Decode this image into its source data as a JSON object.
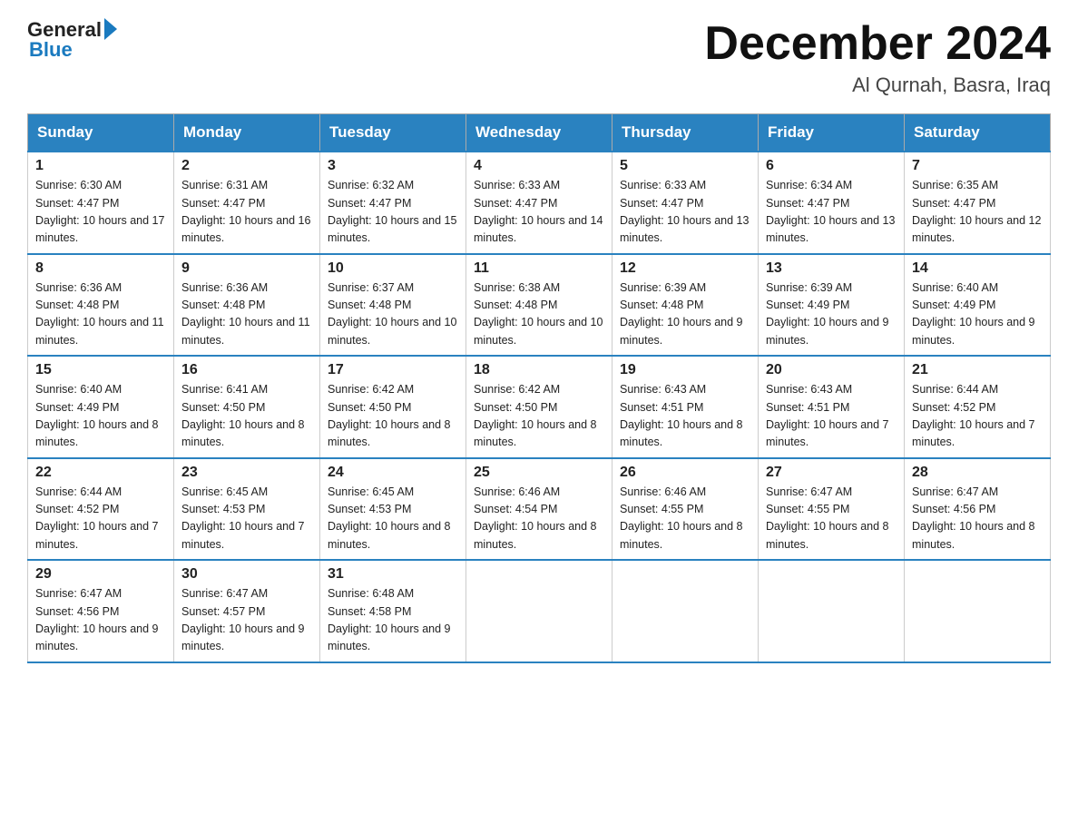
{
  "header": {
    "logo_general": "General",
    "logo_blue": "Blue",
    "month_title": "December 2024",
    "location": "Al Qurnah, Basra, Iraq"
  },
  "days_of_week": [
    "Sunday",
    "Monday",
    "Tuesday",
    "Wednesday",
    "Thursday",
    "Friday",
    "Saturday"
  ],
  "weeks": [
    [
      {
        "day": "1",
        "sunrise": "6:30 AM",
        "sunset": "4:47 PM",
        "daylight": "10 hours and 17 minutes."
      },
      {
        "day": "2",
        "sunrise": "6:31 AM",
        "sunset": "4:47 PM",
        "daylight": "10 hours and 16 minutes."
      },
      {
        "day": "3",
        "sunrise": "6:32 AM",
        "sunset": "4:47 PM",
        "daylight": "10 hours and 15 minutes."
      },
      {
        "day": "4",
        "sunrise": "6:33 AM",
        "sunset": "4:47 PM",
        "daylight": "10 hours and 14 minutes."
      },
      {
        "day": "5",
        "sunrise": "6:33 AM",
        "sunset": "4:47 PM",
        "daylight": "10 hours and 13 minutes."
      },
      {
        "day": "6",
        "sunrise": "6:34 AM",
        "sunset": "4:47 PM",
        "daylight": "10 hours and 13 minutes."
      },
      {
        "day": "7",
        "sunrise": "6:35 AM",
        "sunset": "4:47 PM",
        "daylight": "10 hours and 12 minutes."
      }
    ],
    [
      {
        "day": "8",
        "sunrise": "6:36 AM",
        "sunset": "4:48 PM",
        "daylight": "10 hours and 11 minutes."
      },
      {
        "day": "9",
        "sunrise": "6:36 AM",
        "sunset": "4:48 PM",
        "daylight": "10 hours and 11 minutes."
      },
      {
        "day": "10",
        "sunrise": "6:37 AM",
        "sunset": "4:48 PM",
        "daylight": "10 hours and 10 minutes."
      },
      {
        "day": "11",
        "sunrise": "6:38 AM",
        "sunset": "4:48 PM",
        "daylight": "10 hours and 10 minutes."
      },
      {
        "day": "12",
        "sunrise": "6:39 AM",
        "sunset": "4:48 PM",
        "daylight": "10 hours and 9 minutes."
      },
      {
        "day": "13",
        "sunrise": "6:39 AM",
        "sunset": "4:49 PM",
        "daylight": "10 hours and 9 minutes."
      },
      {
        "day": "14",
        "sunrise": "6:40 AM",
        "sunset": "4:49 PM",
        "daylight": "10 hours and 9 minutes."
      }
    ],
    [
      {
        "day": "15",
        "sunrise": "6:40 AM",
        "sunset": "4:49 PM",
        "daylight": "10 hours and 8 minutes."
      },
      {
        "day": "16",
        "sunrise": "6:41 AM",
        "sunset": "4:50 PM",
        "daylight": "10 hours and 8 minutes."
      },
      {
        "day": "17",
        "sunrise": "6:42 AM",
        "sunset": "4:50 PM",
        "daylight": "10 hours and 8 minutes."
      },
      {
        "day": "18",
        "sunrise": "6:42 AM",
        "sunset": "4:50 PM",
        "daylight": "10 hours and 8 minutes."
      },
      {
        "day": "19",
        "sunrise": "6:43 AM",
        "sunset": "4:51 PM",
        "daylight": "10 hours and 8 minutes."
      },
      {
        "day": "20",
        "sunrise": "6:43 AM",
        "sunset": "4:51 PM",
        "daylight": "10 hours and 7 minutes."
      },
      {
        "day": "21",
        "sunrise": "6:44 AM",
        "sunset": "4:52 PM",
        "daylight": "10 hours and 7 minutes."
      }
    ],
    [
      {
        "day": "22",
        "sunrise": "6:44 AM",
        "sunset": "4:52 PM",
        "daylight": "10 hours and 7 minutes."
      },
      {
        "day": "23",
        "sunrise": "6:45 AM",
        "sunset": "4:53 PM",
        "daylight": "10 hours and 7 minutes."
      },
      {
        "day": "24",
        "sunrise": "6:45 AM",
        "sunset": "4:53 PM",
        "daylight": "10 hours and 8 minutes."
      },
      {
        "day": "25",
        "sunrise": "6:46 AM",
        "sunset": "4:54 PM",
        "daylight": "10 hours and 8 minutes."
      },
      {
        "day": "26",
        "sunrise": "6:46 AM",
        "sunset": "4:55 PM",
        "daylight": "10 hours and 8 minutes."
      },
      {
        "day": "27",
        "sunrise": "6:47 AM",
        "sunset": "4:55 PM",
        "daylight": "10 hours and 8 minutes."
      },
      {
        "day": "28",
        "sunrise": "6:47 AM",
        "sunset": "4:56 PM",
        "daylight": "10 hours and 8 minutes."
      }
    ],
    [
      {
        "day": "29",
        "sunrise": "6:47 AM",
        "sunset": "4:56 PM",
        "daylight": "10 hours and 9 minutes."
      },
      {
        "day": "30",
        "sunrise": "6:47 AM",
        "sunset": "4:57 PM",
        "daylight": "10 hours and 9 minutes."
      },
      {
        "day": "31",
        "sunrise": "6:48 AM",
        "sunset": "4:58 PM",
        "daylight": "10 hours and 9 minutes."
      },
      null,
      null,
      null,
      null
    ]
  ]
}
